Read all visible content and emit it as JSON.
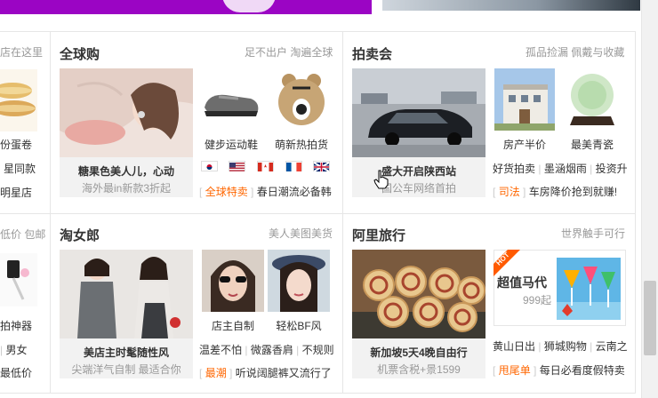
{
  "left_column": {
    "row1_header": "店在这里",
    "row1_items": [
      "份蛋卷",
      "星同款",
      "明星店"
    ],
    "row2_header": "低价 包邮",
    "row2_items": [
      "拍神器",
      "男女",
      "最低价"
    ]
  },
  "quanqiugou": {
    "title": "全球购",
    "subtitle": "足不出户 淘遍全球",
    "main_caption": "糖果色美人儿，心动",
    "main_sub": "海外最in新款3折起",
    "products": [
      "健步运动鞋",
      "萌新热拍货"
    ],
    "flags": [
      "korea-flag",
      "usa-flag",
      "canada-flag",
      "france-flag",
      "uk-flag"
    ],
    "tag": "全球特卖",
    "tag_text": "春日潮流必备韩"
  },
  "paimaihui": {
    "title": "拍卖会",
    "subtitle": "孤品捡漏 佩戴与收藏",
    "main_caption": "盛大开启陕西站",
    "main_sub": "国公车网络首拍",
    "products": [
      "房产半价",
      "最美青瓷"
    ],
    "links": [
      "好货拍卖",
      "墨涵烟雨",
      "投资升"
    ],
    "tag": "司法",
    "tag_text": "车房降价抢到就赚!"
  },
  "taonvlang": {
    "title": "淘女郎",
    "subtitle": "美人美图美货",
    "main_caption": "美店主时髦随性风",
    "main_sub": "尖端洋气自制 最适合你",
    "products": [
      "店主自制",
      "轻松BF风"
    ],
    "links": [
      "温差不怕",
      "微露香肩",
      "不规则"
    ],
    "tag": "最潮",
    "tag_text": "听说阔腿裤又流行了"
  },
  "alitravel": {
    "title": "阿里旅行",
    "subtitle": "世界触手可行",
    "main_caption": "新加坡5天4晚自由行",
    "main_sub": "机票含税+景1599",
    "promo_badge": "HOT",
    "promo_title": "超值马代",
    "promo_price": "999起",
    "links": [
      "黄山日出",
      "狮城购物",
      "云南之"
    ],
    "tag": "甩尾单",
    "tag_text": "每日必看度假特卖"
  }
}
